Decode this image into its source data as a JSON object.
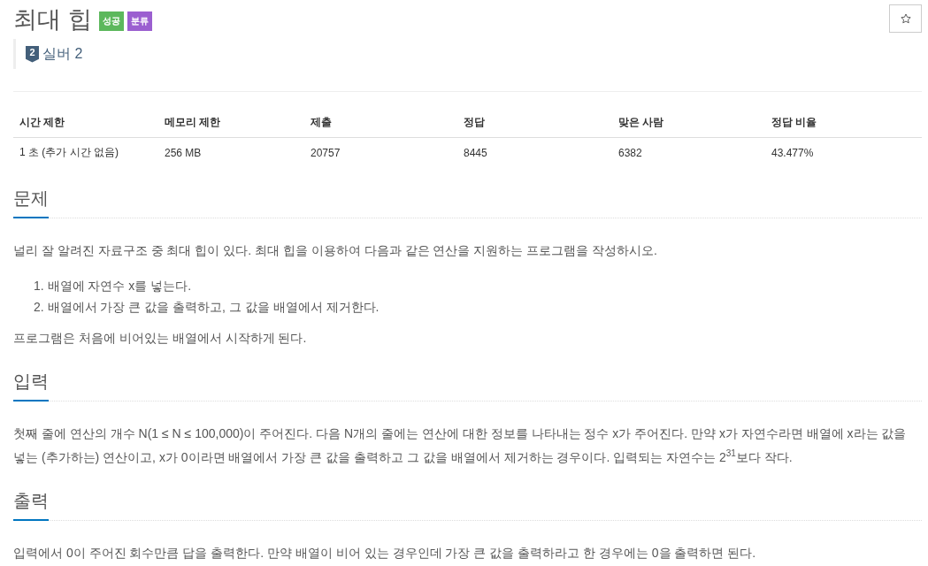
{
  "title": "최대 힙",
  "labels": [
    {
      "text": "성공",
      "color": "#5cb85c"
    },
    {
      "text": "분류",
      "color": "#9b5fd0"
    }
  ],
  "starred": false,
  "tier": {
    "badge": "2",
    "label": "실버 2"
  },
  "stats_table": {
    "columns": [
      "시간 제한",
      "메모리 제한",
      "제출",
      "정답",
      "맞은 사람",
      "정답 비율"
    ],
    "rows": [
      [
        "1 초 (추가 시간 없음)",
        "256 MB",
        "20757",
        "8445",
        "6382",
        "43.477%"
      ]
    ]
  },
  "sections": [
    {
      "heading": "문제",
      "blocks": [
        {
          "kind": "paragraph",
          "text": "널리 잘 알려진 자료구조 중 최대 힙이 있다. 최대 힙을 이용하여 다음과 같은 연산을 지원하는 프로그램을 작성하시오."
        },
        {
          "kind": "ordered_list",
          "items": [
            "1. 배열에 자연수 x를 넣는다.",
            "2. 배열에서 가장 큰 값을 출력하고, 그 값을 배열에서 제거한다."
          ]
        },
        {
          "kind": "paragraph",
          "text": "프로그램은 처음에 비어있는 배열에서 시작하게 된다."
        }
      ]
    },
    {
      "heading": "입력",
      "blocks": [
        {
          "kind": "paragraph",
          "text": "첫째 줄에 연산의 개수 N(1 ≤ N ≤ 100,000)이 주어진다. 다음 N개의 줄에는 연산에 대한 정보를 나타내는 정수 x가 주어진다. 만약 x가 자연수라면 배열에 x라는 값을 넣는 (추가하는) 연산이고, x가 0이라면 배열에서 가장 큰 값을 출력하고 그 값을 배열에서 제거하는 경우이다. 입력되는 자연수는 2$^{31}$보다 작다."
        }
      ]
    },
    {
      "heading": "출력",
      "blocks": [
        {
          "kind": "paragraph",
          "text": "입력에서 0이 주어진 회수만큼 답을 출력한다. 만약 배열이 비어 있는 경우인데 가장 큰 값을 출력하라고 한 경우에는 0을 출력하면 된다."
        }
      ]
    }
  ]
}
